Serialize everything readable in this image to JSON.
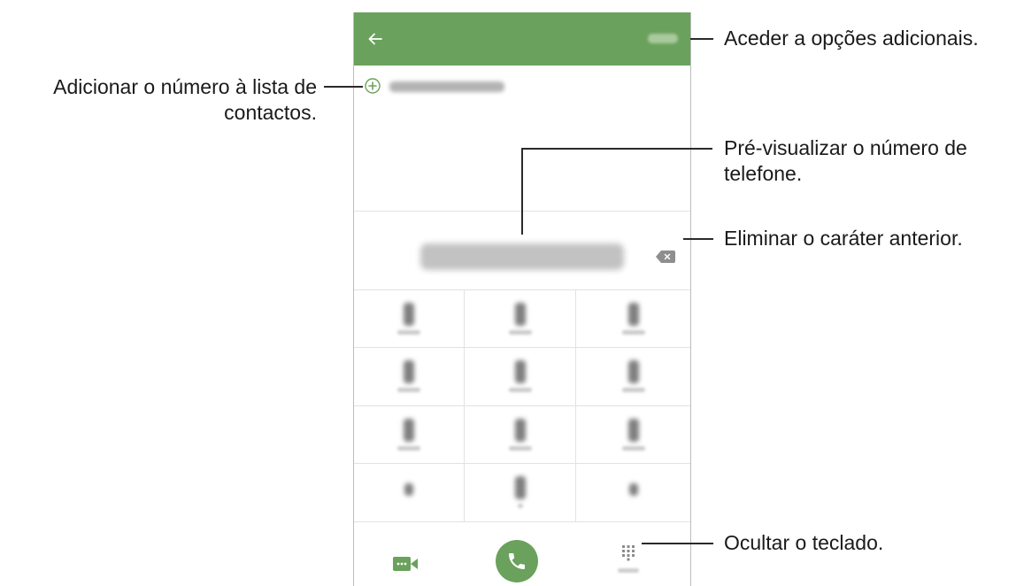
{
  "screen": {
    "appbar": {
      "back_icon": "arrow-left-icon",
      "more_icon": "more-options-icon"
    },
    "add_contact_icon": "plus-circle-icon",
    "backspace_icon": "backspace-icon",
    "keypad_keys": [
      "1",
      "2",
      "3",
      "4",
      "5",
      "6",
      "7",
      "8",
      "9",
      "*",
      "0",
      "#"
    ],
    "bottom": {
      "video_call_icon": "video-call-icon",
      "call_icon": "phone-icon",
      "hide_keypad_icon": "keypad-icon"
    },
    "colors": {
      "accent": "#6aa15c"
    }
  },
  "callouts": {
    "more_options": "Aceder a opções adicionais.",
    "add_contact_line1": "Adicionar o número à lista de",
    "add_contact_line2": "contactos.",
    "preview_line1": "Pré-visualizar o número de",
    "preview_line2": "telefone.",
    "delete_char": "Eliminar o caráter anterior.",
    "hide_keypad": "Ocultar o teclado."
  }
}
